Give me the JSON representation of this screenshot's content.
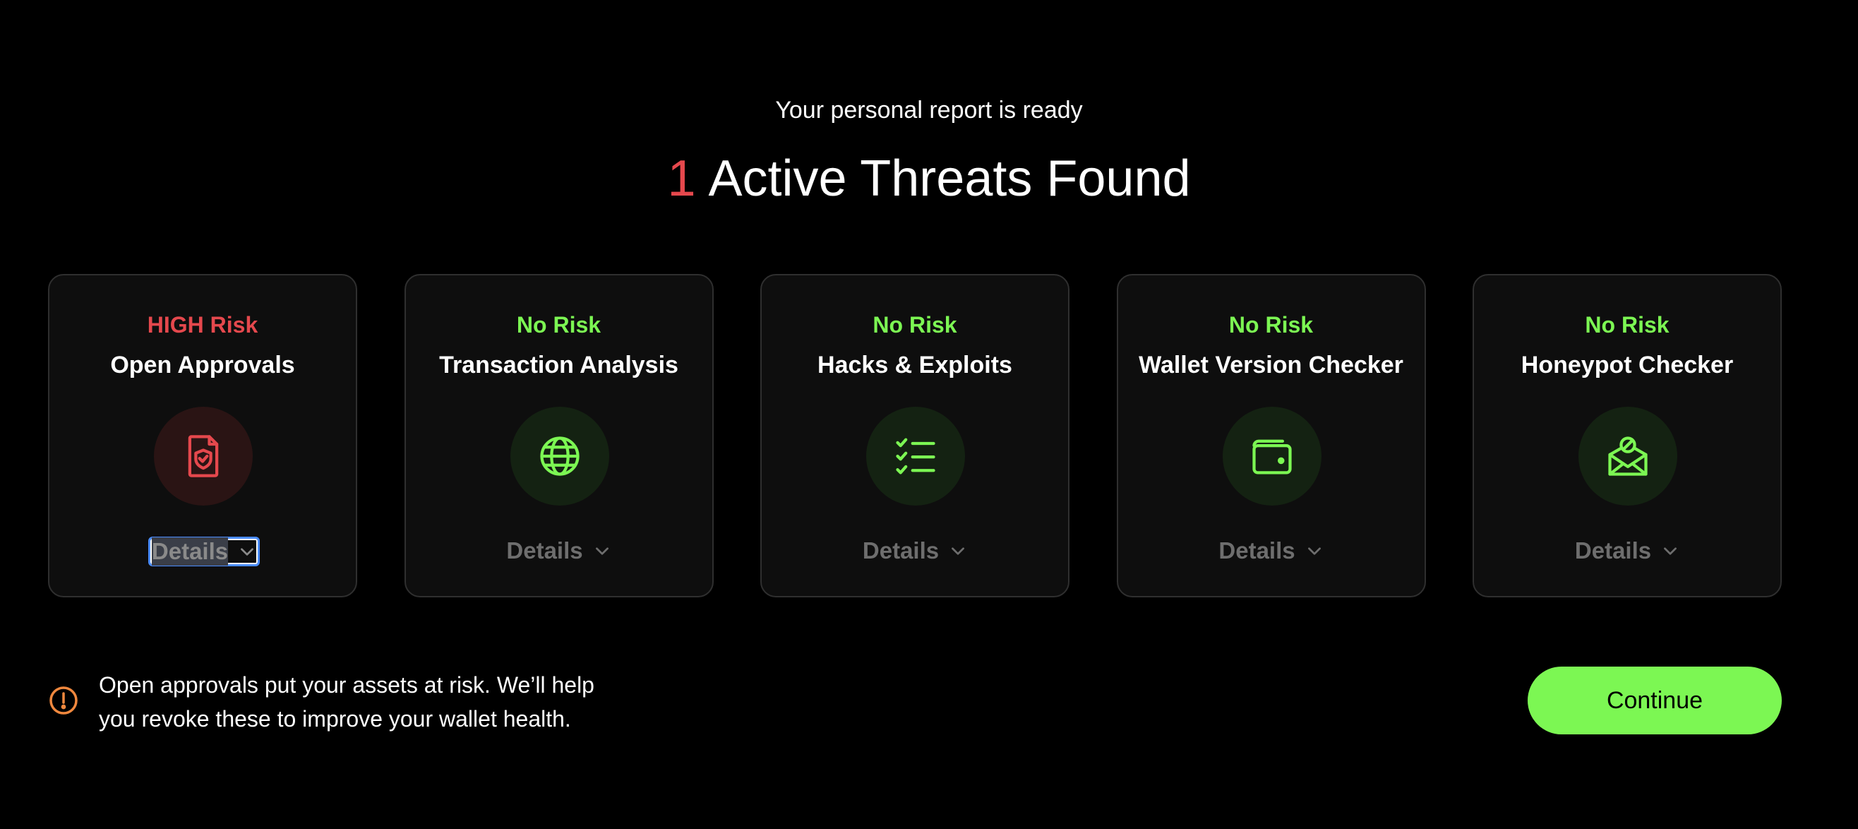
{
  "header": {
    "subtitle": "Your personal report is ready",
    "threat_count": "1",
    "headline": "Active Threats Found"
  },
  "colors": {
    "high_risk": "#e5484d",
    "no_risk": "#7cf753",
    "accent_button": "#7cf753",
    "warning": "#f0883e"
  },
  "cards": [
    {
      "risk": "HIGH Risk",
      "title": "Open Approvals",
      "icon": "shield-document-icon",
      "details_label": "Details",
      "level": "high"
    },
    {
      "risk": "No Risk",
      "title": "Transaction Analysis",
      "icon": "globe-icon",
      "details_label": "Details",
      "level": "none"
    },
    {
      "risk": "No Risk",
      "title": "Hacks & Exploits",
      "icon": "checklist-icon",
      "details_label": "Details",
      "level": "none"
    },
    {
      "risk": "No Risk",
      "title": "Wallet Version Checker",
      "icon": "wallet-icon",
      "details_label": "Details",
      "level": "none"
    },
    {
      "risk": "No Risk",
      "title": "Honeypot Checker",
      "icon": "envelope-block-icon",
      "details_label": "Details",
      "level": "none"
    }
  ],
  "footer": {
    "warning_icon": "warning-circle-icon",
    "note": "Open approvals put your assets at risk. We’ll help you revoke these to improve your wallet health.",
    "continue_label": "Continue"
  }
}
